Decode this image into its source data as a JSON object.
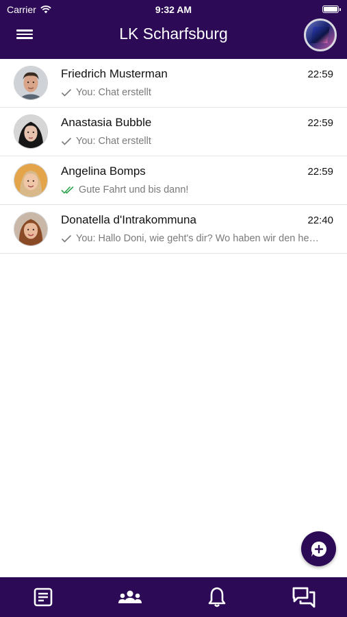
{
  "status_bar": {
    "carrier": "Carrier",
    "time": "9:32 AM"
  },
  "header": {
    "title": "LK Scharfsburg"
  },
  "colors": {
    "brand": "#2c0a55",
    "read_check": "#2ea44f",
    "sent_check": "#7a7a7a"
  },
  "chats": [
    {
      "name": "Friedrich Musterman",
      "time": "22:59",
      "preview": "You: Chat erstellt",
      "status": "sent"
    },
    {
      "name": "Anastasia Bubble",
      "time": "22:59",
      "preview": "You: Chat erstellt",
      "status": "sent"
    },
    {
      "name": "Angelina Bomps",
      "time": "22:59",
      "preview": "Gute Fahrt und bis dann!",
      "status": "read"
    },
    {
      "name": "Donatella d'Intrakommuna",
      "time": "22:40",
      "preview": "You: Hallo Doni, wie geht's dir? Wo haben wir den he…",
      "status": "sent"
    }
  ],
  "fab": {
    "icon": "new-chat-icon"
  },
  "bottom_nav": [
    {
      "icon": "document-icon"
    },
    {
      "icon": "group-icon"
    },
    {
      "icon": "bell-icon"
    },
    {
      "icon": "chat-bubbles-icon"
    }
  ]
}
